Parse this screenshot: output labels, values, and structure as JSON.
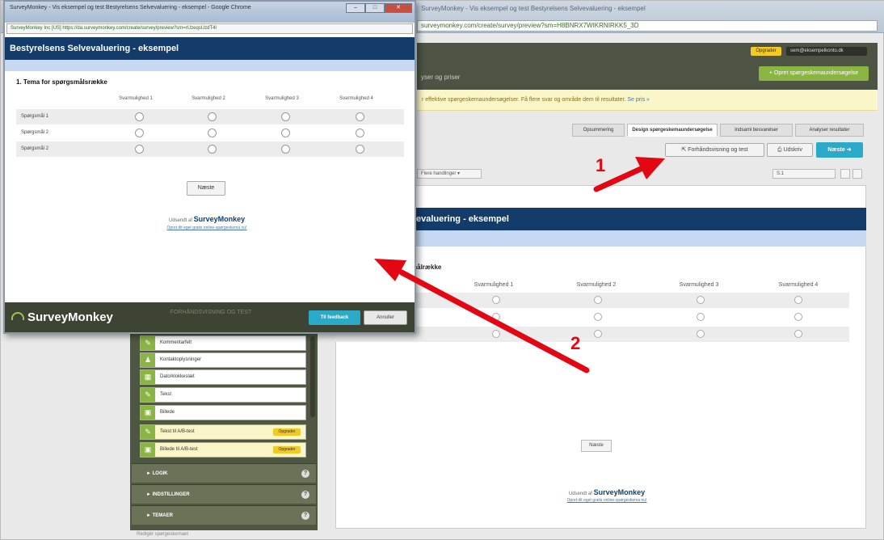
{
  "background_window": {
    "title_text": "SurveyMonkey - Vis eksempel og test Bestyrelsens Selvevaluering - eksempel",
    "url": "surveymonkey.com/create/survey/preview?sm=H8BNRX7WIKRNIRKK5_3D",
    "header": {
      "upgrade_label": "Opgrader",
      "user_label": "sem@eksempelkonto.dk",
      "create_button": "+ Opret spørgeskemaundersøgelse",
      "subnav_text": "yser og priser"
    },
    "info_bar": {
      "text": "r effektive spørgeskemaundersøgelser. Få flere svar og område dem til resultater.",
      "link": "Se pris »"
    },
    "tabs": [
      {
        "label": "Opsummering",
        "active": false
      },
      {
        "label": "Design spørgeskemaundersøgelse",
        "active": true
      },
      {
        "label": "Indsaml besvarelser",
        "active": false
      },
      {
        "label": "Analyser resultater",
        "active": false
      }
    ],
    "toolbar": {
      "preview_label": "Forhåndsvisning og test",
      "print_label": "Udskriv",
      "next_label": "Næste"
    },
    "page_actions_label": "Flere handlinger",
    "page_select_value": "S.1",
    "canvas": {
      "survey_title_fragment": "evaluering - eksempel",
      "question_fragment": "målrække",
      "columns": [
        "Svarmulighed 1",
        "Svarmulighed 2",
        "Svarmulighed 3",
        "Svarmulighed 4"
      ],
      "row_count": 3,
      "next_label": "Næste",
      "powered_prefix": "Udsendt af",
      "powered_brand": "SurveyMonkey",
      "create_link": "Opret dit eget gratis online-spørgeskema nu!"
    },
    "builder": {
      "items": [
        {
          "label": "Kommentarfelt",
          "icon": "comment-icon",
          "upgrade": false
        },
        {
          "label": "Kontaktoplysninger",
          "icon": "contact-icon",
          "upgrade": false
        },
        {
          "label": "Dato/klokkeslæt",
          "icon": "calendar-icon",
          "upgrade": false
        },
        {
          "label": "Tekst",
          "icon": "text-icon",
          "upgrade": false
        },
        {
          "label": "Billede",
          "icon": "image-icon",
          "upgrade": false
        },
        {
          "label": "Tekst til A/B-test",
          "icon": "ab-text-icon",
          "upgrade": true
        },
        {
          "label": "Billede til A/B-test",
          "icon": "ab-image-icon",
          "upgrade": true
        }
      ],
      "upgrade_tag": "Opgrader",
      "sections": [
        {
          "label": "► LOGIK"
        },
        {
          "label": "► INDSTILLINGER"
        },
        {
          "label": "► TEMAER"
        }
      ],
      "bottom_link": "Redigér spørgeskemaet"
    }
  },
  "popup": {
    "title_text": "SurveyMonkey - Vis eksempel og test Bestyrelsens Selvevaluering - eksempel - Google Chrome",
    "url": "SurveyMonkey Inc [US] https://da.surveymonkey.com/create/survey/preview?sm=rUzeqsUzdT4l",
    "survey_title": "Bestyrelsens Selvevaluering - eksempel",
    "question_title": "1. Tema for spørgsmålsrække",
    "columns": [
      "Svarmulighed 1",
      "Svarmulighed 2",
      "Svarmulighed 3",
      "Svarmulighed 4"
    ],
    "rows": [
      "Spørgsmål 1",
      "Spørgsmål 2",
      "Spørgsmål 2"
    ],
    "next_label": "Næste",
    "powered_prefix": "Udsendt af",
    "powered_brand": "SurveyMonkey",
    "create_link": "Opret dit eget gratis online-spørgeskema nu!",
    "footer": {
      "logo_text": "SurveyMonkey",
      "mode_text": "FORHÅNDSVISNING OG TEST",
      "feedback_label": "Til feedback",
      "cancel_label": "Annuller"
    }
  },
  "annotations": [
    {
      "number": "1"
    },
    {
      "number": "2"
    }
  ],
  "colors": {
    "survey_title_bg": "#133c6b",
    "survey_strip_bg": "#c7d9f2",
    "sm_dark": "#3e4434",
    "sm_green": "#8ab443",
    "accent_blue": "#2aa9c8",
    "annotation_red": "#e30613"
  }
}
